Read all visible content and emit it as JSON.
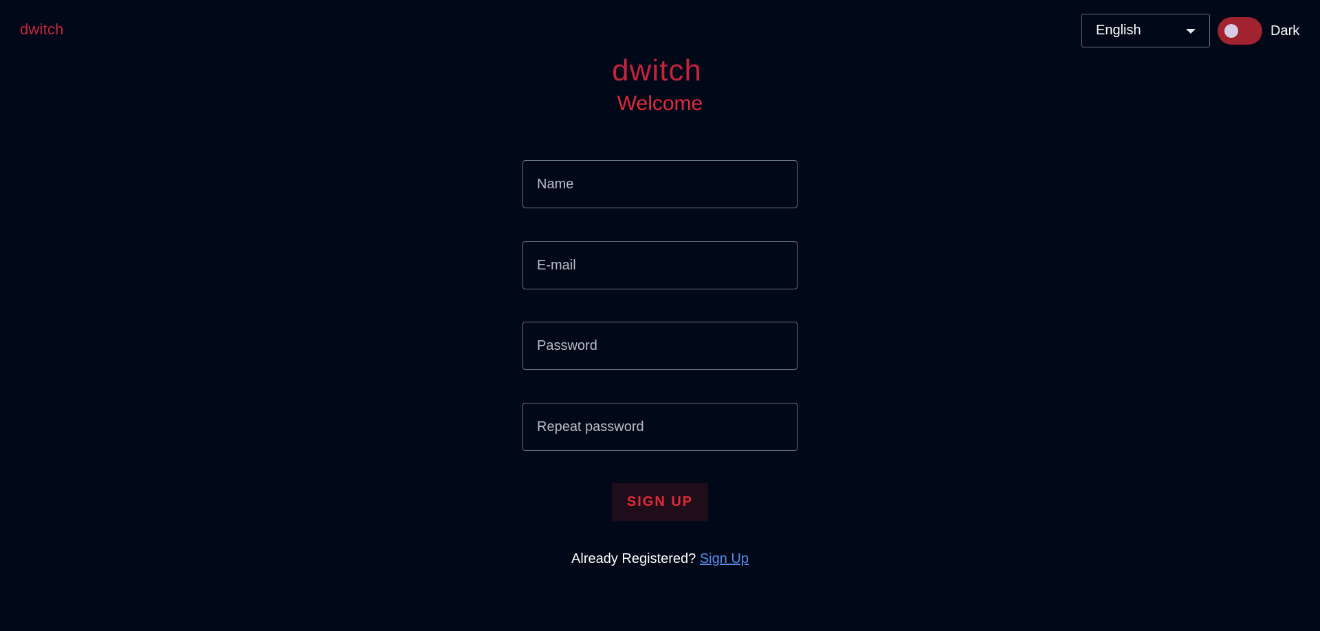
{
  "header": {
    "logo_text": "dwitch",
    "language": {
      "selected": "English",
      "icon": "caret-down-icon"
    },
    "theme_toggle": {
      "label": "Dark",
      "state": "on"
    }
  },
  "main": {
    "logo_text": "dwitch",
    "welcome": "Welcome",
    "form": {
      "name_placeholder": "Name",
      "email_placeholder": "E-mail",
      "password_placeholder": "Password",
      "repeat_password_placeholder": "Repeat password",
      "submit_label": "SIGN UP"
    },
    "footer": {
      "prompt": "Already Registered?",
      "link_label": "Sign Up"
    }
  },
  "colors": {
    "background": "#010817",
    "accent": "#e32a3c",
    "link": "#5b8def",
    "toggle_track": "#a0232f"
  }
}
